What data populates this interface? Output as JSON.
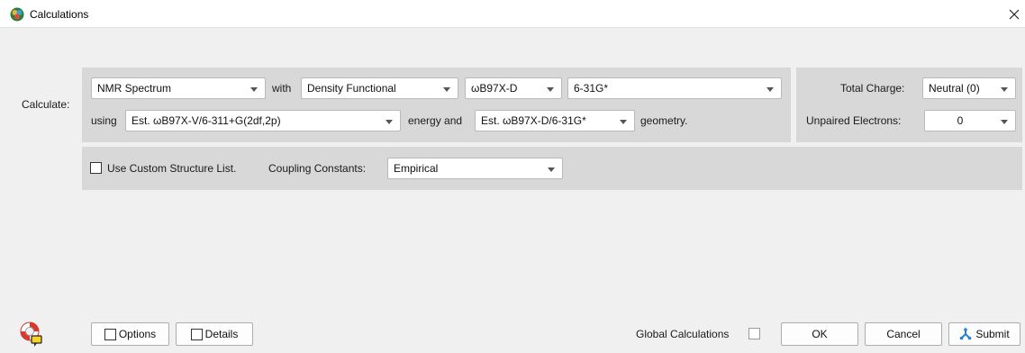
{
  "window": {
    "title": "Calculations"
  },
  "calculate": {
    "label": "Calculate:",
    "type": "NMR Spectrum",
    "with_label": "with",
    "method": "Density Functional",
    "functional": "ωB97X-D",
    "basis": "6-31G*",
    "using_label": "using",
    "energy": "Est. ωB97X-V/6-311+G(2df,2p)",
    "energy_and_label": "energy and",
    "geometry": "Est. ωB97X-D/6-31G*",
    "geometry_label": "geometry."
  },
  "charge": {
    "total_charge_label": "Total Charge:",
    "total_charge": "Neutral (0)",
    "unpaired_label": "Unpaired Electrons:",
    "unpaired": "0"
  },
  "options_row": {
    "custom_structure_label": "Use Custom Structure List.",
    "coupling_label": "Coupling Constants:",
    "coupling": "Empirical"
  },
  "footer": {
    "options_label": "Options",
    "details_label": "Details",
    "global_label": "Global Calculations",
    "ok_label": "OK",
    "cancel_label": "Cancel",
    "submit_label": "Submit"
  }
}
